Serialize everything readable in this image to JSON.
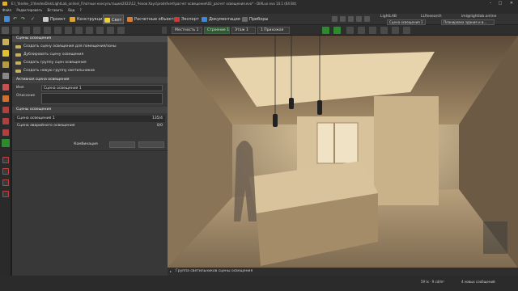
{
  "window": {
    "title": "E:\\_Yandex_1\\YandexDisk\\LightLab_online\\_Платные консультации\\2023\\12_Чехов Хаус\\prodsfvert\\расчет освещения\\02_расчет освещения.evo* - DIALux evo 10.1 (64 Bit)"
  },
  "menu": [
    "Файл",
    "Редактировать",
    "Вставить",
    "Вид",
    "?"
  ],
  "tabs": [
    {
      "label": "Проект",
      "color": "#c9c9c9"
    },
    {
      "label": "Конструкция",
      "color": "#d9a43a"
    },
    {
      "label": "Свет",
      "color": "#f0d030"
    },
    {
      "label": "Расчетные объекты",
      "color": "#e07a2a"
    },
    {
      "label": "Экспорт",
      "color": "#c83a3a"
    },
    {
      "label": "Документация",
      "color": "#3a8ad6"
    },
    {
      "label": "Приборы",
      "color": "#6a6a6a"
    }
  ],
  "top_right": {
    "lightlab": "LightLAB",
    "user1": "LLResearch",
    "email": "iml@lightlab.online",
    "scene_select": "Сцена освещения 1",
    "building_select": "Планировка здания и в..."
  },
  "toolbar": {
    "location": "Местность 1",
    "building": "Строение 1",
    "floor": "Этаж 1",
    "room": "1 Прихожая"
  },
  "panel": {
    "header": "Сцены освещения",
    "actions": [
      "Создать сцену освещения для помещения/зоны",
      "Дублировать сцену освещения",
      "Создать группу сцен освещения",
      "Создать новую группу светильников"
    ],
    "active_scene_header": "Активная сцена освещения",
    "name_label": "Имя",
    "name_value": "Сцена освещения 1",
    "description_label": "Описание",
    "scenes_header": "Сцены освещения",
    "scenes": [
      {
        "name": "Сцена освещения 1",
        "value": "135/4"
      },
      {
        "name": "Сцена аварийного освещения",
        "value": "0/0"
      }
    ],
    "combination_label": "Комбинация"
  },
  "viewport_status": "Группа светильников сцены освещения",
  "statusbar": {
    "units": "59 lx · 9 cd/m²",
    "messages": "4 новых сообщений"
  }
}
